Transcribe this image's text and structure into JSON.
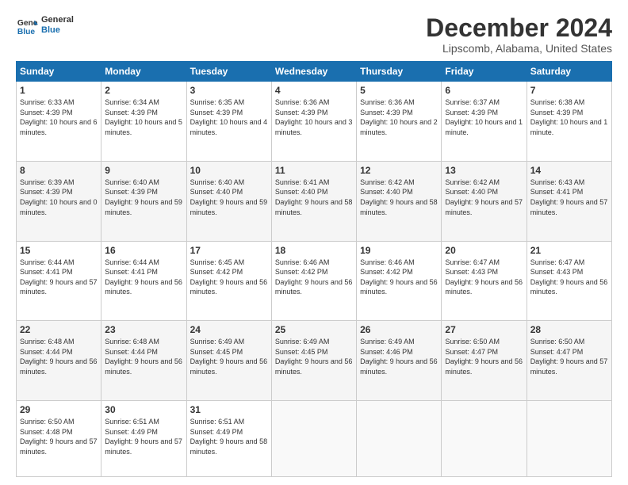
{
  "header": {
    "logo_line1": "General",
    "logo_line2": "Blue",
    "title": "December 2024",
    "subtitle": "Lipscomb, Alabama, United States"
  },
  "days_of_week": [
    "Sunday",
    "Monday",
    "Tuesday",
    "Wednesday",
    "Thursday",
    "Friday",
    "Saturday"
  ],
  "weeks": [
    [
      {
        "day": "1",
        "sunrise": "6:33 AM",
        "sunset": "4:39 PM",
        "daylight": "10 hours and 6 minutes."
      },
      {
        "day": "2",
        "sunrise": "6:34 AM",
        "sunset": "4:39 PM",
        "daylight": "10 hours and 5 minutes."
      },
      {
        "day": "3",
        "sunrise": "6:35 AM",
        "sunset": "4:39 PM",
        "daylight": "10 hours and 4 minutes."
      },
      {
        "day": "4",
        "sunrise": "6:36 AM",
        "sunset": "4:39 PM",
        "daylight": "10 hours and 3 minutes."
      },
      {
        "day": "5",
        "sunrise": "6:36 AM",
        "sunset": "4:39 PM",
        "daylight": "10 hours and 2 minutes."
      },
      {
        "day": "6",
        "sunrise": "6:37 AM",
        "sunset": "4:39 PM",
        "daylight": "10 hours and 1 minute."
      },
      {
        "day": "7",
        "sunrise": "6:38 AM",
        "sunset": "4:39 PM",
        "daylight": "10 hours and 1 minute."
      }
    ],
    [
      {
        "day": "8",
        "sunrise": "6:39 AM",
        "sunset": "4:39 PM",
        "daylight": "10 hours and 0 minutes."
      },
      {
        "day": "9",
        "sunrise": "6:40 AM",
        "sunset": "4:39 PM",
        "daylight": "9 hours and 59 minutes."
      },
      {
        "day": "10",
        "sunrise": "6:40 AM",
        "sunset": "4:40 PM",
        "daylight": "9 hours and 59 minutes."
      },
      {
        "day": "11",
        "sunrise": "6:41 AM",
        "sunset": "4:40 PM",
        "daylight": "9 hours and 58 minutes."
      },
      {
        "day": "12",
        "sunrise": "6:42 AM",
        "sunset": "4:40 PM",
        "daylight": "9 hours and 58 minutes."
      },
      {
        "day": "13",
        "sunrise": "6:42 AM",
        "sunset": "4:40 PM",
        "daylight": "9 hours and 57 minutes."
      },
      {
        "day": "14",
        "sunrise": "6:43 AM",
        "sunset": "4:41 PM",
        "daylight": "9 hours and 57 minutes."
      }
    ],
    [
      {
        "day": "15",
        "sunrise": "6:44 AM",
        "sunset": "4:41 PM",
        "daylight": "9 hours and 57 minutes."
      },
      {
        "day": "16",
        "sunrise": "6:44 AM",
        "sunset": "4:41 PM",
        "daylight": "9 hours and 56 minutes."
      },
      {
        "day": "17",
        "sunrise": "6:45 AM",
        "sunset": "4:42 PM",
        "daylight": "9 hours and 56 minutes."
      },
      {
        "day": "18",
        "sunrise": "6:46 AM",
        "sunset": "4:42 PM",
        "daylight": "9 hours and 56 minutes."
      },
      {
        "day": "19",
        "sunrise": "6:46 AM",
        "sunset": "4:42 PM",
        "daylight": "9 hours and 56 minutes."
      },
      {
        "day": "20",
        "sunrise": "6:47 AM",
        "sunset": "4:43 PM",
        "daylight": "9 hours and 56 minutes."
      },
      {
        "day": "21",
        "sunrise": "6:47 AM",
        "sunset": "4:43 PM",
        "daylight": "9 hours and 56 minutes."
      }
    ],
    [
      {
        "day": "22",
        "sunrise": "6:48 AM",
        "sunset": "4:44 PM",
        "daylight": "9 hours and 56 minutes."
      },
      {
        "day": "23",
        "sunrise": "6:48 AM",
        "sunset": "4:44 PM",
        "daylight": "9 hours and 56 minutes."
      },
      {
        "day": "24",
        "sunrise": "6:49 AM",
        "sunset": "4:45 PM",
        "daylight": "9 hours and 56 minutes."
      },
      {
        "day": "25",
        "sunrise": "6:49 AM",
        "sunset": "4:45 PM",
        "daylight": "9 hours and 56 minutes."
      },
      {
        "day": "26",
        "sunrise": "6:49 AM",
        "sunset": "4:46 PM",
        "daylight": "9 hours and 56 minutes."
      },
      {
        "day": "27",
        "sunrise": "6:50 AM",
        "sunset": "4:47 PM",
        "daylight": "9 hours and 56 minutes."
      },
      {
        "day": "28",
        "sunrise": "6:50 AM",
        "sunset": "4:47 PM",
        "daylight": "9 hours and 57 minutes."
      }
    ],
    [
      {
        "day": "29",
        "sunrise": "6:50 AM",
        "sunset": "4:48 PM",
        "daylight": "9 hours and 57 minutes."
      },
      {
        "day": "30",
        "sunrise": "6:51 AM",
        "sunset": "4:49 PM",
        "daylight": "9 hours and 57 minutes."
      },
      {
        "day": "31",
        "sunrise": "6:51 AM",
        "sunset": "4:49 PM",
        "daylight": "9 hours and 58 minutes."
      },
      null,
      null,
      null,
      null
    ]
  ]
}
